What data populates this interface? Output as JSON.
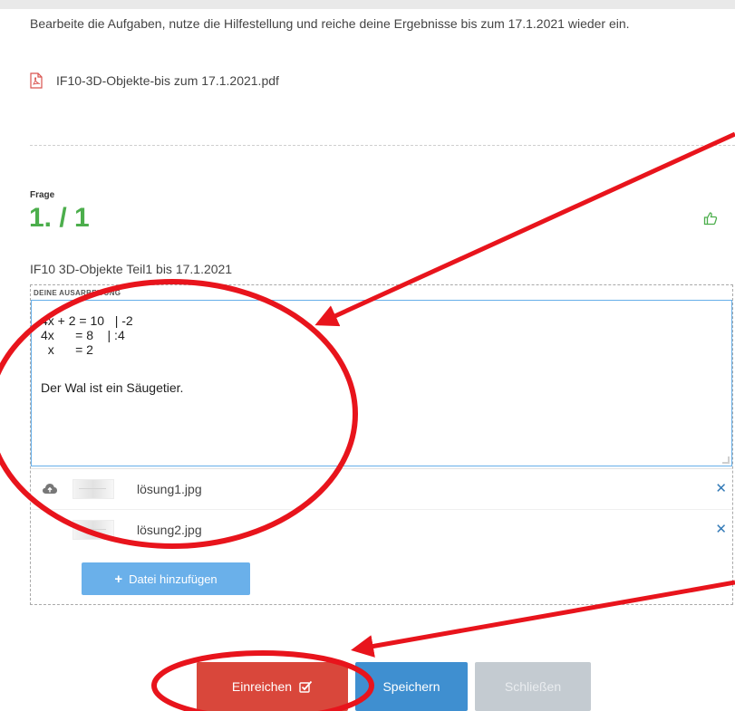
{
  "task": {
    "instructions": "Bearbeite die Aufgaben, nutze die Hilfestellung und reiche deine Ergebnisse bis zum 17.1.2021 wieder ein.",
    "attachment_name": "IF10-3D-Objekte-bis zum 17.1.2021.pdf"
  },
  "question": {
    "label": "Frage",
    "number": "1. / 1",
    "title": "IF10 3D-Objekte Teil1 bis 17.1.2021"
  },
  "answer": {
    "section_label": "DEINE AUSARBEITUNG",
    "lines": [
      "4x + 2 = 10   | -2",
      "4x      = 8    | :4",
      "  x      = 2",
      "",
      "Der Wal ist ein Säugetier."
    ],
    "files": [
      {
        "name": "lösung1.jpg"
      },
      {
        "name": "lösung2.jpg"
      }
    ],
    "add_file_label": "Datei hinzufügen"
  },
  "buttons": {
    "submit": "Einreichen",
    "save": "Speichern",
    "close": "Schließen"
  },
  "icons": {
    "attachment": "pdf-icon",
    "rating": "thumbs-up-icon",
    "upload": "cloud-upload-icon",
    "remove": "close-icon",
    "add": "plus-icon",
    "submit": "check-square-icon"
  },
  "colors": {
    "question_number": "#4cae4c",
    "submit": "#d9473b",
    "save": "#3f8fd0",
    "close": "#c4cbd1",
    "add_file": "#6ab0ea",
    "annotation": "#e8141c"
  }
}
